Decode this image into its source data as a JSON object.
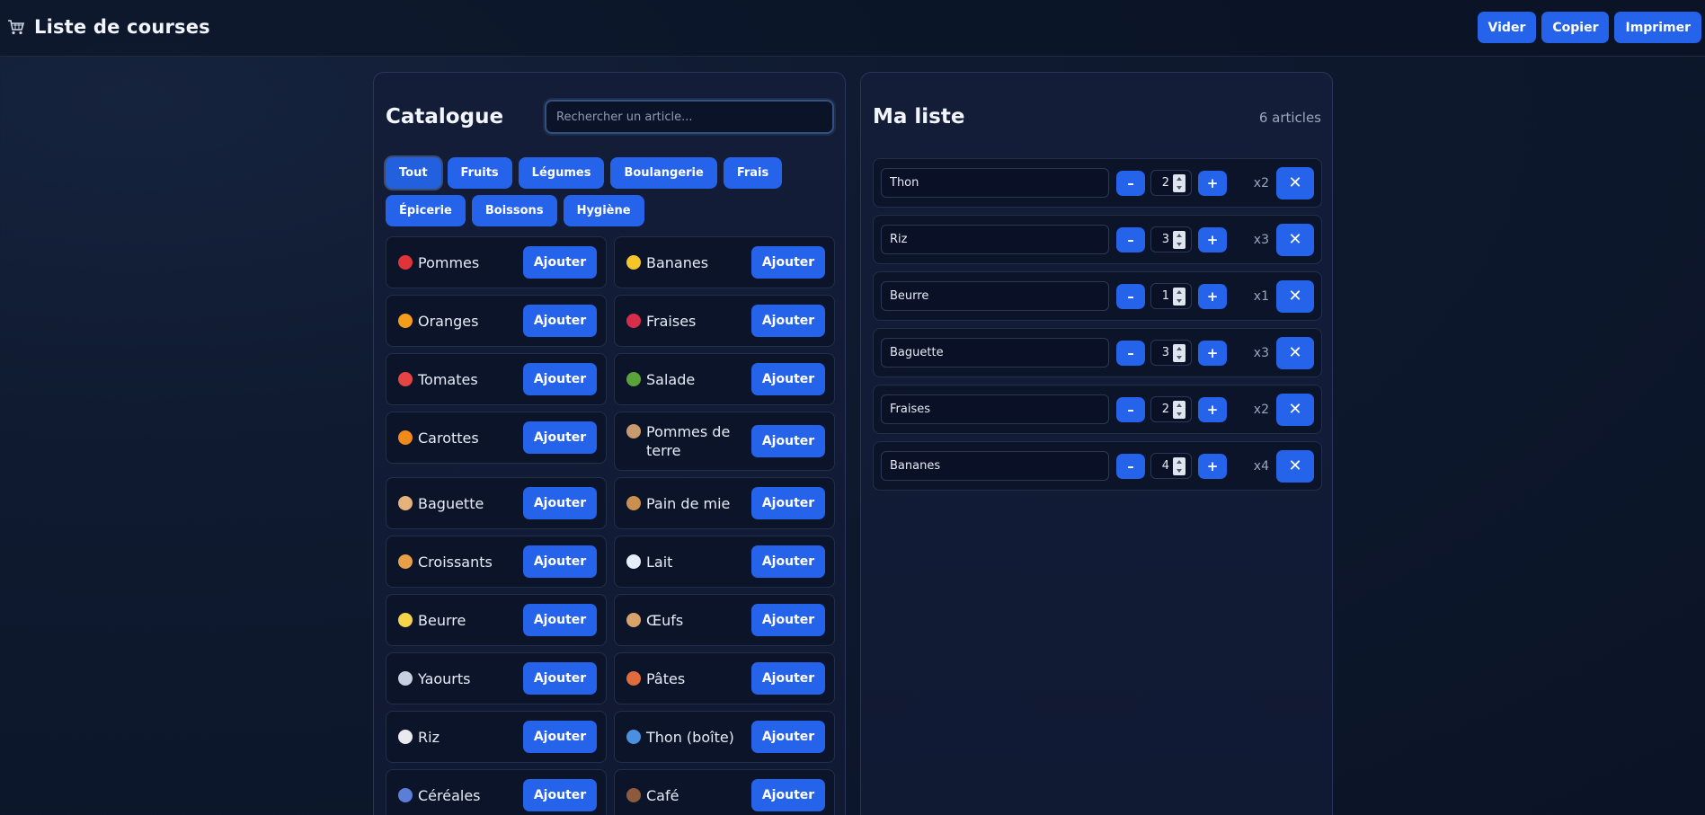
{
  "header": {
    "title": "Liste de courses",
    "actions": [
      "Vider",
      "Copier",
      "Imprimer"
    ]
  },
  "catalogue": {
    "title": "Catalogue",
    "search_placeholder": "Rechercher un article...",
    "filters": [
      "Tout",
      "Fruits",
      "Légumes",
      "Boulangerie",
      "Frais",
      "Épicerie",
      "Boissons",
      "Hygiène"
    ],
    "active_filter": "Tout",
    "add_label": "Ajouter",
    "items": [
      {
        "label": "Pommes",
        "icon": "apple-icon",
        "color": "#e0343a"
      },
      {
        "label": "Bananes",
        "icon": "banana-icon",
        "color": "#f4c62a"
      },
      {
        "label": "Oranges",
        "icon": "orange-icon",
        "color": "#f59e1b"
      },
      {
        "label": "Fraises",
        "icon": "strawberry-icon",
        "color": "#d62d4b"
      },
      {
        "label": "Tomates",
        "icon": "tomato-icon",
        "color": "#e54444"
      },
      {
        "label": "Salade",
        "icon": "lettuce-icon",
        "color": "#5aa33a"
      },
      {
        "label": "Carottes",
        "icon": "carrot-icon",
        "color": "#f08a1c"
      },
      {
        "label": "Pommes de terre",
        "icon": "potato-icon",
        "color": "#c99a6b"
      },
      {
        "label": "Baguette",
        "icon": "baguette-icon",
        "color": "#e5b27c"
      },
      {
        "label": "Pain de mie",
        "icon": "bread-box-icon",
        "color": "#c8914f"
      },
      {
        "label": "Croissants",
        "icon": "croissant-icon",
        "color": "#e8a048"
      },
      {
        "label": "Lait",
        "icon": "milk-glass-icon",
        "color": "#e8eef7"
      },
      {
        "label": "Beurre",
        "icon": "butter-icon",
        "color": "#f5d34a"
      },
      {
        "label": "Œufs",
        "icon": "egg-icon",
        "color": "#d9a26a"
      },
      {
        "label": "Yaourts",
        "icon": "yogurt-icon",
        "color": "#c7cfe0"
      },
      {
        "label": "Pâtes",
        "icon": "pasta-icon",
        "color": "#e06b3c"
      },
      {
        "label": "Riz",
        "icon": "rice-icon",
        "color": "#e9e9ef"
      },
      {
        "label": "Thon (boîte)",
        "icon": "fish-icon",
        "color": "#4a8fe0"
      },
      {
        "label": "Céréales",
        "icon": "cereal-icon",
        "color": "#5b7fd6"
      },
      {
        "label": "Café",
        "icon": "coffee-icon",
        "color": "#8c5a3c"
      }
    ]
  },
  "my_list": {
    "title": "Ma liste",
    "count_text": "6 articles",
    "minus_label": "–",
    "plus_label": "+",
    "remove_label": "✕",
    "rows": [
      {
        "name": "Thon",
        "qty": "2",
        "mult": "x2"
      },
      {
        "name": "Riz",
        "qty": "3",
        "mult": "x3"
      },
      {
        "name": "Beurre",
        "qty": "1",
        "mult": "x1"
      },
      {
        "name": "Baguette",
        "qty": "3",
        "mult": "x3"
      },
      {
        "name": "Fraises",
        "qty": "2",
        "mult": "x2"
      },
      {
        "name": "Bananes",
        "qty": "4",
        "mult": "x4"
      }
    ]
  }
}
